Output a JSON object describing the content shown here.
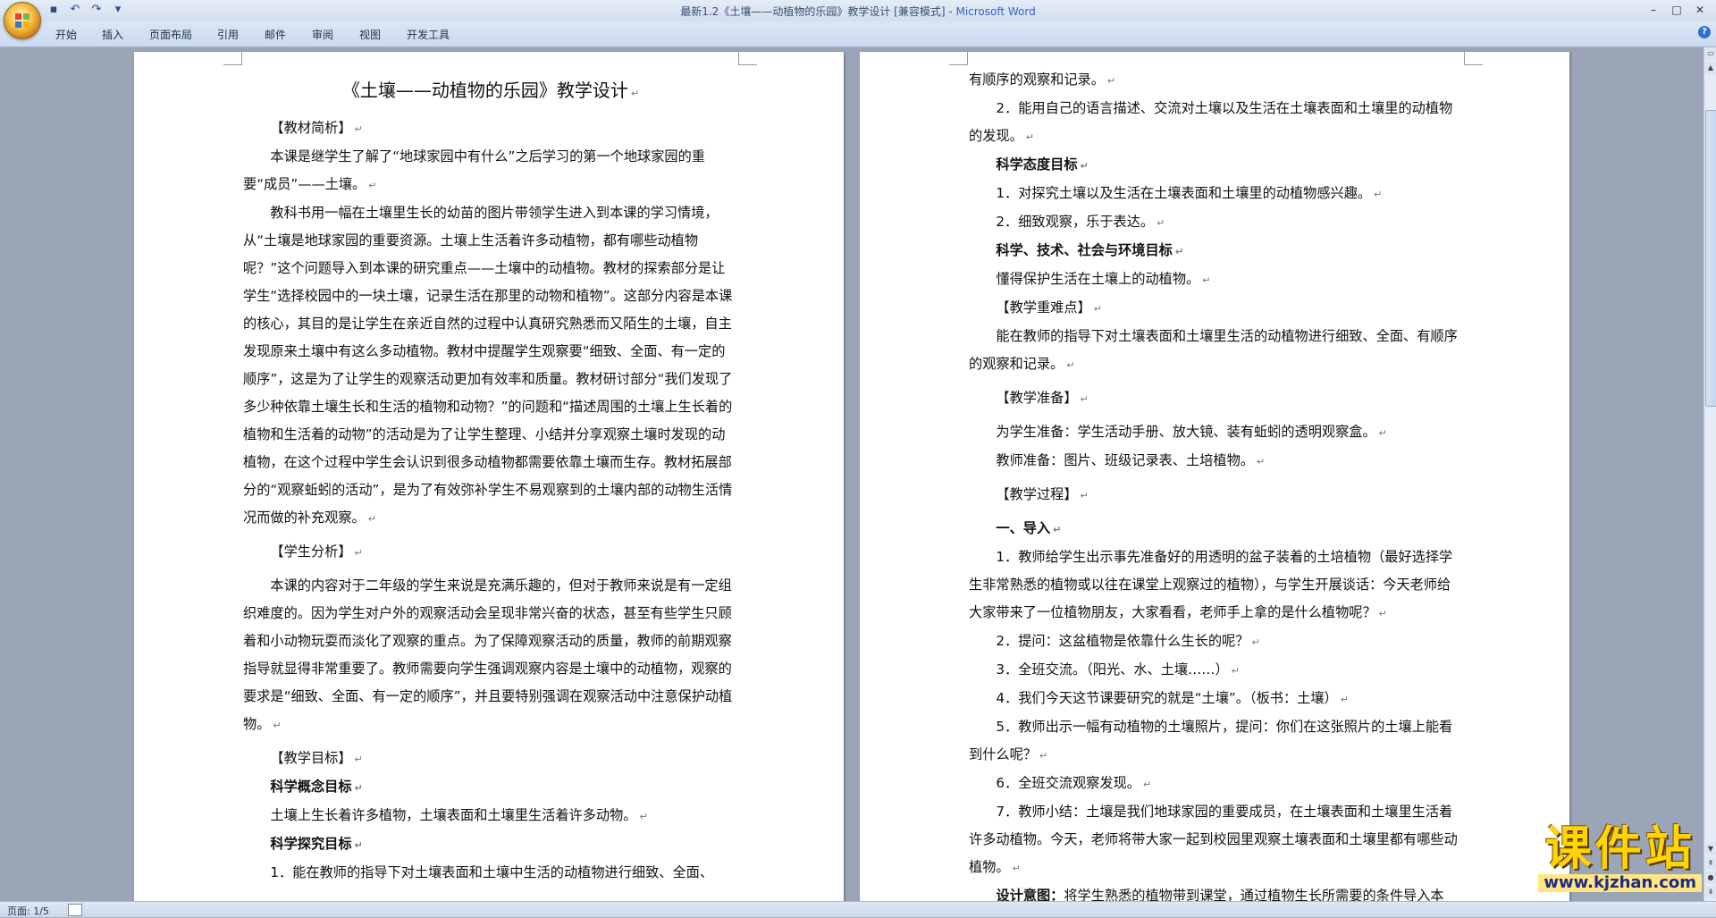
{
  "window": {
    "title": "最新1.2《土壤——动植物的乐园》教学设计 [兼容模式] - ",
    "app": "Microsoft Word",
    "quick_access": [
      "save-icon",
      "undo-icon",
      "redo-icon",
      "customize-icon"
    ],
    "controls": [
      "minimize",
      "maximize",
      "close"
    ]
  },
  "ribbon": {
    "tabs": [
      "开始",
      "插入",
      "页面布局",
      "引用",
      "邮件",
      "审阅",
      "视图",
      "开发工具"
    ]
  },
  "page1": {
    "title": "《土壤——动植物的乐园》教学设计",
    "h_intro": "【教材简析】",
    "intro_p1": "本课是继学生了解了“地球家园中有什么”之后学习的第一个地球家园的重要“成员”——土壤。",
    "intro_p2": "教科书用一幅在土壤里生长的幼苗的图片带领学生进入到本课的学习情境，从“土壤是地球家园的重要资源。土壤上生活着许多动植物，都有哪些动植物呢？”这个问题导入到本课的研究重点——土壤中的动植物。教材的探索部分是让学生“选择校园中的一块土壤，记录生活在那里的动物和植物”。这部分内容是本课的核心，其目的是让学生在亲近自然的过程中认真研究熟悉而又陌生的土壤，自主发现原来土壤中有这么多动植物。教材中提醒学生观察要“细致、全面、有一定的顺序”，这是为了让学生的观察活动更加有效率和质量。教材研讨部分“我们发现了多少种依靠土壤生长和生活的植物和动物？”的问题和“描述周围的土壤上生长着的植物和生活着的动物”的活动是为了让学生整理、小结并分享观察土壤时发现的动植物，在这个过程中学生会认识到很多动植物都需要依靠土壤而生存。教材拓展部分的“观察蚯蚓的活动”，是为了有效弥补学生不易观察到的土壤内部的动物生活情况而做的补充观察。",
    "h_student": "【学生分析】",
    "student_p": "本课的内容对于二年级的学生来说是充满乐趣的，但对于教师来说是有一定组织难度的。因为学生对户外的观察活动会呈现非常兴奋的状态，甚至有些学生只顾着和小动物玩耍而淡化了观察的重点。为了保障观察活动的质量，教师的前期观察指导就显得非常重要了。教师需要向学生强调观察内容是土壤中的动植物，观察的要求是“细致、全面、有一定的顺序”，并且要特别强调在观察活动中注意保护动植物。",
    "h_goals": "【教学目标】",
    "h_concept": "科学概念目标",
    "concept_p": "土壤上生长着许多植物，土壤表面和土壤里生活着许多动物。",
    "h_inquiry": "科学探究目标",
    "inquiry_1": "1．能在教师的指导下对土壤表面和土壤中生活的动植物进行细致、全面、"
  },
  "page2": {
    "cont_1": "有顺序的观察和记录。",
    "inquiry_2": "2．能用自己的语言描述、交流对土壤以及生活在土壤表面和土壤里的动植物的发现。",
    "h_attitude": "科学态度目标",
    "attitude_1": "1．对探究土壤以及生活在土壤表面和土壤里的动植物感兴趣。",
    "attitude_2": "2．细致观察，乐于表达。",
    "h_stse": "科学、技术、社会与环境目标",
    "stse_p": "懂得保护生活在土壤上的动植物。",
    "h_key": "【教学重难点】",
    "key_p": "能在教师的指导下对土壤表面和土壤里生活的动植物进行细致、全面、有顺序的观察和记录。",
    "h_prep": "【教学准备】",
    "prep_1": "为学生准备：学生活动手册、放大镜、装有蚯蚓的透明观察盒。",
    "prep_2": "教师准备：图片、班级记录表、土培植物。",
    "h_process": "【教学过程】",
    "h_step1": "一、导入",
    "step_1": "1．教师给学生出示事先准备好的用透明的盆子装着的土培植物（最好选择学生非常熟悉的植物或以往在课堂上观察过的植物），与学生开展谈话：今天老师给大家带来了一位植物朋友，大家看看，老师手上拿的是什么植物呢？",
    "step_2": "2．提问：这盆植物是依靠什么生长的呢？",
    "step_3": "3．全班交流。（阳光、水、土壤……）",
    "step_4": "4．我们今天这节课要研究的就是“土壤”。（板书：土壤）",
    "step_5": "5．教师出示一幅有动植物的土壤照片，提问：你们在这张照片的土壤上能看到什么呢？",
    "step_6": "6．全班交流观察发现。",
    "step_7": "7．教师小结：土壤是我们地球家园的重要成员，在土壤表面和土壤里生活着许多动植物。今天，老师将带大家一起到校园里观察土壤表面和土壤里都有哪些动植物。",
    "design_label": "设计意图：",
    "design_text": "将学生熟悉的植物带到课堂，通过植物生长所需要的条件导入本"
  },
  "status": {
    "page": "页面: 1/5"
  },
  "watermark": {
    "text": "课件站",
    "url": "www.kjzhan.com"
  },
  "colors": {
    "word_blue": "#3462c8",
    "watermark_yellow": "#ffd400",
    "watermark_url": "#1b2a8a"
  }
}
